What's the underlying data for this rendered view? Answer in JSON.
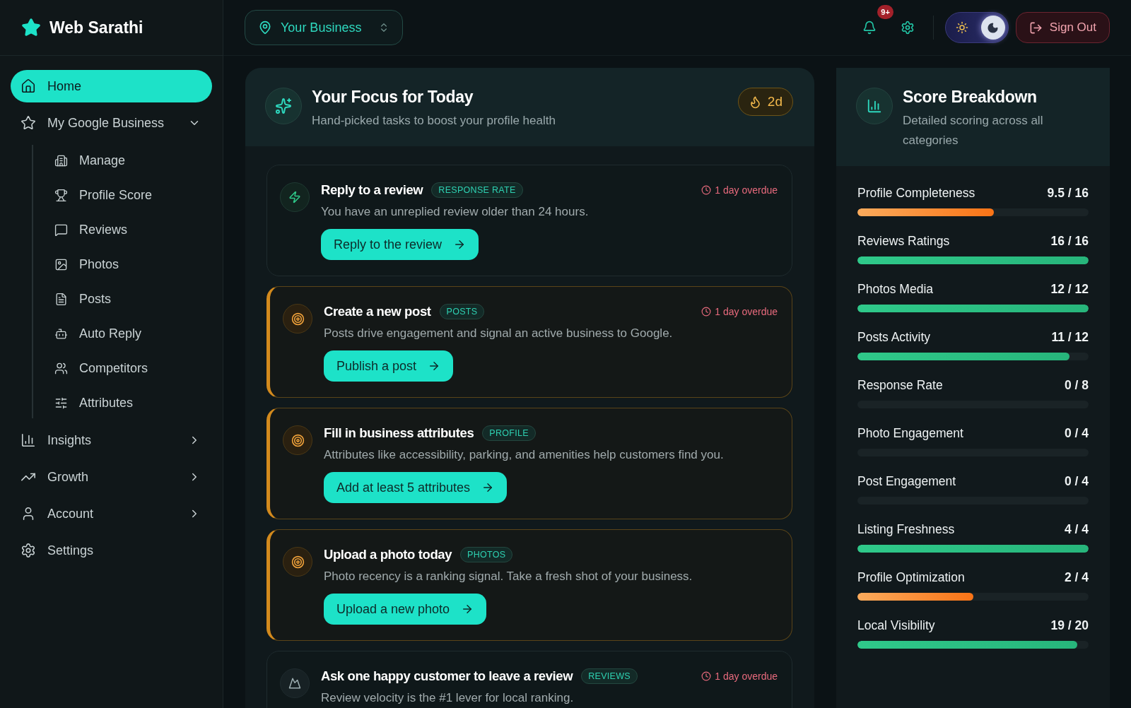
{
  "brand": {
    "name": "Web Sarathi"
  },
  "business_selector": {
    "value": "Your Business"
  },
  "header": {
    "notifications_badge": "9+",
    "dark_mode": true,
    "sign_out": "Sign Out"
  },
  "sidebar": {
    "items": [
      {
        "label": "Home",
        "kind": "home",
        "selected": true
      },
      {
        "label": "My Google Business",
        "kind": "star",
        "selected": false,
        "expanded": true,
        "children": [
          {
            "label": "Manage",
            "kind": "building",
            "selected": false
          },
          {
            "label": "Profile Score",
            "kind": "trophy",
            "selected": false
          },
          {
            "label": "Reviews",
            "kind": "message",
            "selected": false
          },
          {
            "label": "Photos",
            "kind": "image",
            "selected": false
          },
          {
            "label": "Posts",
            "kind": "file",
            "selected": false
          },
          {
            "label": "Auto Reply",
            "kind": "bot",
            "selected": false
          },
          {
            "label": "Competitors",
            "kind": "users",
            "selected": false
          },
          {
            "label": "Attributes",
            "kind": "sliders",
            "selected": false
          }
        ]
      },
      {
        "label": "Insights",
        "kind": "chart",
        "selected": false,
        "expanded": false
      },
      {
        "label": "Growth",
        "kind": "trend",
        "selected": false,
        "expanded": false
      },
      {
        "label": "Account",
        "kind": "user",
        "selected": false,
        "expanded": false
      },
      {
        "label": "Settings",
        "kind": "gear",
        "selected": false
      }
    ]
  },
  "focus": {
    "title": "Your Focus for Today",
    "subtitle": "Hand-picked tasks to boost your profile health",
    "streak": "2d",
    "tasks": [
      {
        "kind": "bolt",
        "highlighted": false,
        "title": "Reply to a review",
        "tag": "RESPONSE RATE",
        "due": "1 day overdue",
        "description": "You have an unreplied review older than 24 hours.",
        "action": "Reply to the review"
      },
      {
        "kind": "target",
        "highlighted": true,
        "title": "Create a new post",
        "tag": "POSTS",
        "due": "1 day overdue",
        "description": "Posts drive engagement and signal an active business to Google.",
        "action": "Publish a post"
      },
      {
        "kind": "target",
        "highlighted": true,
        "title": "Fill in business attributes",
        "tag": "PROFILE",
        "description": "Attributes like accessibility, parking, and amenities help customers find you.",
        "action": "Add at least 5 attributes"
      },
      {
        "kind": "target",
        "highlighted": true,
        "title": "Upload a photo today",
        "tag": "PHOTOS",
        "description": "Photo recency is a ranking signal. Take a fresh shot of your business.",
        "action": "Upload a new photo"
      },
      {
        "kind": "peak",
        "highlighted": false,
        "title": "Ask one happy customer to leave a review",
        "tag": "REVIEWS",
        "due": "1 day overdue",
        "description": "Review velocity is the #1 lever for local ranking."
      }
    ]
  },
  "score": {
    "title": "Score Breakdown",
    "subtitle": "Detailed scoring across all categories",
    "items": [
      {
        "label": "Profile Completeness",
        "value": "9.5 / 16",
        "level": 0.59
      },
      {
        "label": "Reviews Ratings",
        "value": "16 / 16",
        "level": 1
      },
      {
        "label": "Photos Media",
        "value": "12 / 12",
        "level": 1
      },
      {
        "label": "Posts Activity",
        "value": "11 / 12",
        "level": 0.917
      },
      {
        "label": "Response Rate",
        "value": "0 / 8",
        "level": 0
      },
      {
        "label": "Photo Engagement",
        "value": "0 / 4",
        "level": 0
      },
      {
        "label": "Post Engagement",
        "value": "0 / 4",
        "level": 0
      },
      {
        "label": "Listing Freshness",
        "value": "4 / 4",
        "level": 1
      },
      {
        "label": "Profile Optimization",
        "value": "2 / 4",
        "level": 0.5
      },
      {
        "label": "Local Visibility",
        "value": "19 / 20",
        "level": 0.95
      }
    ]
  }
}
